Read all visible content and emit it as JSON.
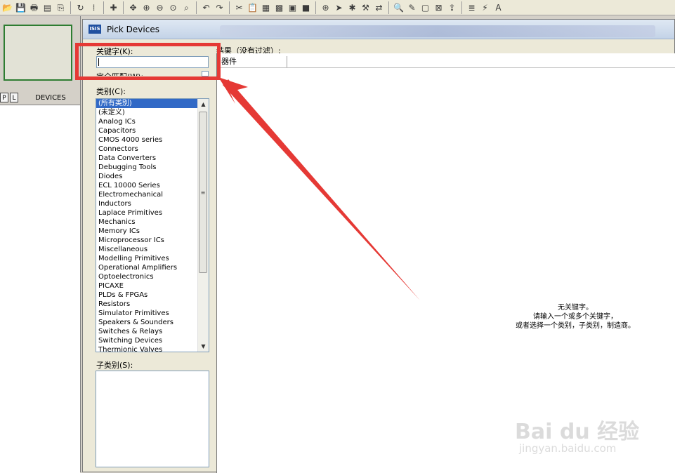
{
  "toolbar": {
    "icons": [
      "open-icon",
      "save-icon",
      "print-icon",
      "print-setup-icon",
      "copy-icon",
      "refresh-icon",
      "grid-icon",
      "origin-icon",
      "pan-icon",
      "zoom-in-icon",
      "zoom-out-icon",
      "zoom-all-icon",
      "zoom-area-icon",
      "undo-icon",
      "redo-icon",
      "cut-icon",
      "paste-icon",
      "block-copy-icon",
      "block-move-icon",
      "block-rotate-icon",
      "block-delete-icon",
      "pick-device-icon",
      "make-device-icon",
      "package-icon",
      "decompose-icon",
      "wire-autorouter-icon",
      "search-icon",
      "property-tool-icon",
      "new-sheet-icon",
      "delete-sheet-icon",
      "goto-sheet-icon",
      "bom-icon",
      "erc-icon",
      "ares-icon"
    ],
    "glyphs": {
      "open-icon": "📂",
      "save-icon": "💾",
      "print-icon": "🖶",
      "print-setup-icon": "▤",
      "copy-icon": "⎘",
      "refresh-icon": "↻",
      "grid-icon": "⁞",
      "origin-icon": "✚",
      "pan-icon": "✥",
      "zoom-in-icon": "⊕",
      "zoom-out-icon": "⊖",
      "zoom-all-icon": "⊙",
      "zoom-area-icon": "⌕",
      "undo-icon": "↶",
      "redo-icon": "↷",
      "cut-icon": "✂",
      "paste-icon": "📋",
      "block-copy-icon": "▦",
      "block-move-icon": "▩",
      "block-rotate-icon": "▣",
      "block-delete-icon": "■",
      "pick-device-icon": "⊛",
      "make-device-icon": "➤",
      "package-icon": "✱",
      "decompose-icon": "⚒",
      "wire-autorouter-icon": "⇄",
      "search-icon": "🔍",
      "property-tool-icon": "✎",
      "new-sheet-icon": "▢",
      "delete-sheet-icon": "⊠",
      "goto-sheet-icon": "⇪",
      "bom-icon": "≣",
      "erc-icon": "⚡",
      "ares-icon": "A"
    }
  },
  "left_panel": {
    "p_button": "P",
    "l_button": "L",
    "devices_label": "DEVICES"
  },
  "dialog": {
    "icon_text": "ISIS",
    "title": "Pick Devices",
    "keyword_label": "关键字(K):",
    "keyword_value": "",
    "match_whole_label": "完全匹配(W):",
    "category_label": "类别(C):",
    "categories": [
      "(所有类别)",
      "(未定义)",
      "Analog ICs",
      "Capacitors",
      "CMOS 4000 series",
      "Connectors",
      "Data Converters",
      "Debugging Tools",
      "Diodes",
      "ECL 10000 Series",
      "Electromechanical",
      "Inductors",
      "Laplace Primitives",
      "Mechanics",
      "Memory ICs",
      "Microprocessor ICs",
      "Miscellaneous",
      "Modelling Primitives",
      "Operational Amplifiers",
      "Optoelectronics",
      "PICAXE",
      "PLDs & FPGAs",
      "Resistors",
      "Simulator Primitives",
      "Speakers & Sounders",
      "Switches & Relays",
      "Switching Devices",
      "Thermionic Valves"
    ],
    "selected_category_index": 0,
    "subcategory_label": "子类别(S):",
    "results_label": "结果（没有过滤）:",
    "results_column": "器件",
    "results_message": [
      "无关键字。",
      "请输入一个或多个关键字，",
      "或者选择一个类别，子类别，制造商。"
    ]
  },
  "watermark": {
    "brand": "Bai du 经验",
    "url": "jingyan.baidu.com"
  },
  "colors": {
    "highlight": "#e53935",
    "selection": "#3169c6"
  }
}
